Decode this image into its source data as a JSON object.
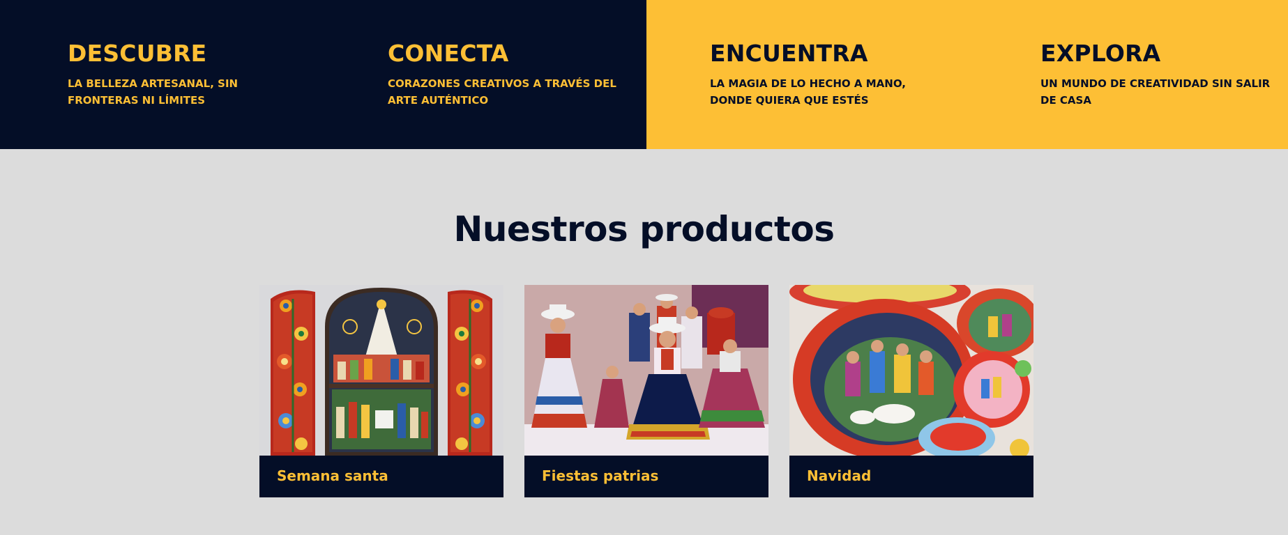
{
  "colors": {
    "navy": "#040e27",
    "gold": "#fdbf35",
    "page_background": "#dcdcdc"
  },
  "features": [
    {
      "title": "DESCUBRE",
      "text": "LA BELLEZA ARTESANAL, SIN FRONTERAS NI LÍMITES"
    },
    {
      "title": "CONECTA",
      "text": "CORAZONES CREATIVOS A TRAVÉS DEL ARTE AUTÉNTICO"
    },
    {
      "title": "ENCUENTRA",
      "text": "LA MAGIA DE LO HECHO A MANO, DONDE QUIERA QUE ESTÉS"
    },
    {
      "title": "EXPLORA",
      "text": "UN MUNDO DE CREATIVIDAD SIN SALIR DE CASA"
    }
  ],
  "products": {
    "title": "Nuestros productos",
    "items": [
      {
        "label": "Semana santa"
      },
      {
        "label": "Fiestas patrias"
      },
      {
        "label": "Navidad"
      }
    ]
  }
}
